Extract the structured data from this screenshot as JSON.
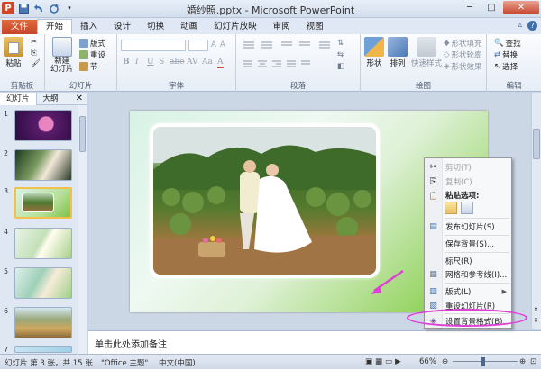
{
  "window": {
    "title": "婚纱照.pptx - Microsoft PowerPoint",
    "controls": {
      "minimize": "─",
      "maximize": "□",
      "close": "✕"
    }
  },
  "quick_access": {
    "logo": "P",
    "save_icon": "save-icon",
    "undo_icon": "undo-icon",
    "redo_icon": "redo-icon"
  },
  "tabs": [
    "文件",
    "开始",
    "插入",
    "设计",
    "切换",
    "动画",
    "幻灯片放映",
    "审阅",
    "视图"
  ],
  "active_tab": "开始",
  "ribbon": {
    "clipboard": {
      "paste": "粘贴",
      "label": "剪贴板"
    },
    "slides": {
      "new_slide": "新建\n幻灯片",
      "layout": "版式",
      "reset": "重设",
      "section": "节",
      "label": "幻灯片"
    },
    "font": {
      "label": "字体",
      "buttons": [
        "B",
        "I",
        "U",
        "S",
        "abe",
        "AV",
        "Aa",
        "A"
      ]
    },
    "paragraph": {
      "label": "段落"
    },
    "drawing": {
      "shape": "形状",
      "arrange": "排列",
      "quick_styles": "快速样式",
      "fill": "形状填充",
      "outline": "形状轮廓",
      "effects": "形状效果",
      "label": "绘图"
    },
    "editing": {
      "find": "查找",
      "replace": "替换",
      "select": "选择",
      "label": "编辑"
    }
  },
  "left_pane": {
    "tabs": [
      "幻灯片",
      "大纲"
    ],
    "close": "✕",
    "slides": [
      "1",
      "2",
      "3",
      "4",
      "5",
      "6",
      "7"
    ]
  },
  "notes": {
    "placeholder": "单击此处添加备注"
  },
  "status": {
    "slide_info": "幻灯片 第 3 张，共 15 张",
    "theme": "\"Office 主题\"",
    "language": "中文(中国)",
    "zoom": "66%"
  },
  "context_menu": {
    "items": [
      {
        "label": "剪切(T)",
        "icon": "✂",
        "disabled": true
      },
      {
        "label": "复制(C)",
        "icon": "⎘",
        "disabled": true
      },
      {
        "label": "粘贴选项:",
        "icon": "📋",
        "disabled": false,
        "bold": true
      },
      {
        "label": "发布幻灯片(S)",
        "icon": "▤",
        "disabled": false
      },
      {
        "label": "保存背景(S)...",
        "icon": "",
        "disabled": false
      },
      {
        "label": "标尺(R)",
        "icon": "",
        "disabled": false
      },
      {
        "label": "网格和参考线(I)...",
        "icon": "▦",
        "disabled": false
      },
      {
        "label": "版式(L)",
        "icon": "▥",
        "disabled": false,
        "submenu": true
      },
      {
        "label": "重设幻灯片(R)",
        "icon": "▧",
        "disabled": false
      },
      {
        "label": "设置背景格式(B)...",
        "icon": "◈",
        "disabled": false
      }
    ]
  },
  "colors": {
    "file_tab": "#c5462a",
    "annotation": "#e040d8"
  }
}
